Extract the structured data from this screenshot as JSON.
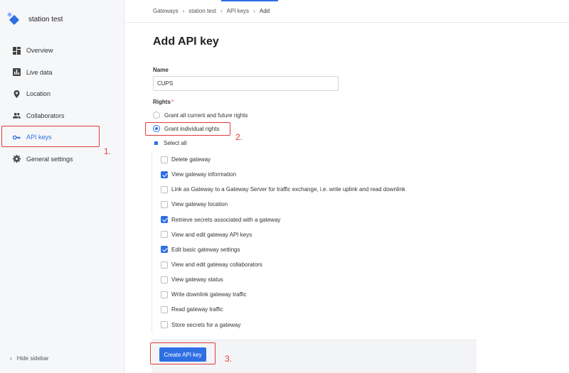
{
  "sidebar": {
    "gateway_name": "station test",
    "items": [
      {
        "label": "Overview",
        "icon": "dashboard-icon"
      },
      {
        "label": "Live data",
        "icon": "bar-chart-icon"
      },
      {
        "label": "Location",
        "icon": "location-pin-icon"
      },
      {
        "label": "Collaborators",
        "icon": "people-icon"
      },
      {
        "label": "API keys",
        "icon": "key-icon",
        "active": true
      },
      {
        "label": "General settings",
        "icon": "gear-icon"
      }
    ],
    "hide_label": "Hide sidebar"
  },
  "breadcrumb": [
    "Gateways",
    "station test",
    "API keys",
    "Add"
  ],
  "form": {
    "title": "Add API key",
    "name_label": "Name",
    "name_value": "CUPS",
    "rights_label": "Rights",
    "rights_required_mark": "*",
    "radio_all": "Grant all current and future rights",
    "radio_individual": "Grant individual rights",
    "selected_radio": "Grant individual rights",
    "select_all": "Select all",
    "rights": [
      {
        "label": "Delete gateway",
        "checked": false
      },
      {
        "label": "View gateway information",
        "checked": true
      },
      {
        "label": "Link as Gateway to a Gateway Server for traffic exchange, i.e. write uplink and read downlink",
        "checked": false
      },
      {
        "label": "View gateway location",
        "checked": false
      },
      {
        "label": "Retrieve secrets associated with a gateway",
        "checked": true
      },
      {
        "label": "View and edit gateway API keys",
        "checked": false
      },
      {
        "label": "Edit basic gateway settings",
        "checked": true
      },
      {
        "label": "View and edit gateway collaborators",
        "checked": false
      },
      {
        "label": "View gateway status",
        "checked": false
      },
      {
        "label": "Write downlink gateway traffic",
        "checked": false
      },
      {
        "label": "Read gateway traffic",
        "checked": false
      },
      {
        "label": "Store secrets for a gateway",
        "checked": false
      }
    ],
    "submit_label": "Create API key"
  },
  "annotations": [
    "1.",
    "2.",
    "3."
  ],
  "colors": {
    "accent": "#2f6fe4",
    "annotation": "#e23b3b"
  }
}
